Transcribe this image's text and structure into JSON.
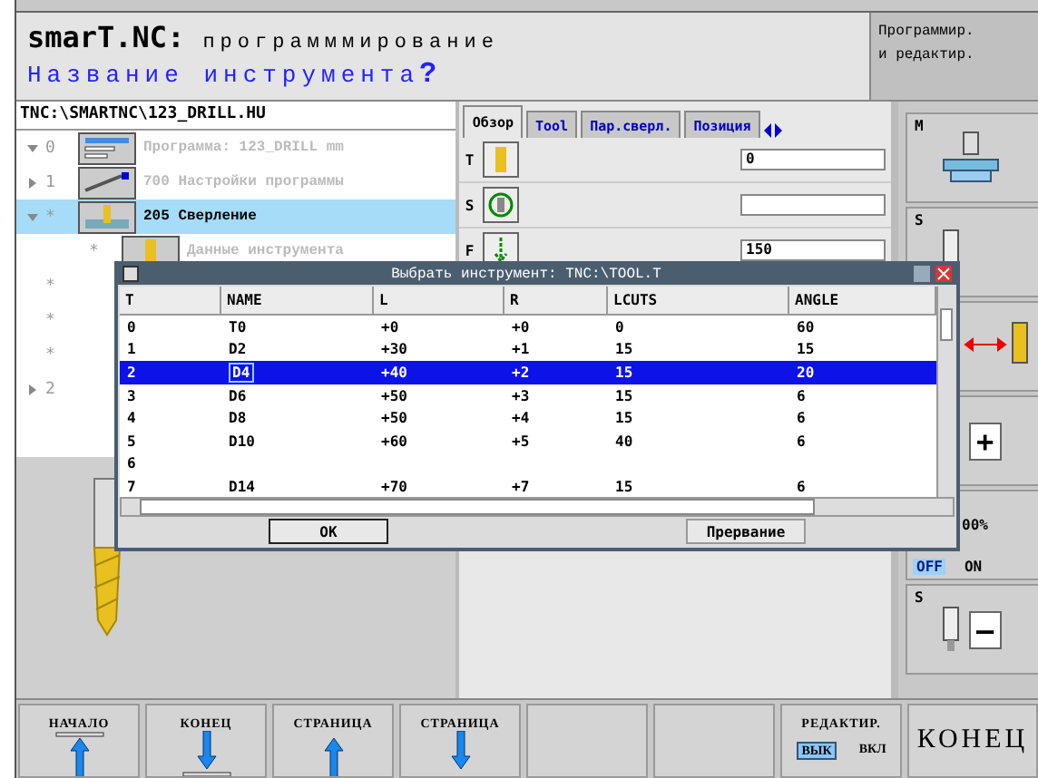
{
  "header": {
    "title": "smarT.NC:",
    "subtitle": "программмирование",
    "prompt": "Название инструмента",
    "prompt_mark": "?",
    "mode": [
      "Программир.",
      "и редактир."
    ]
  },
  "file_path": "TNC:\\SMARTNC\\123_DRILL.HU",
  "tree": [
    {
      "marker": "0",
      "expanded": true,
      "selected": false,
      "kind": "program",
      "label": "Программа: 123_DRILL mm"
    },
    {
      "marker": "1",
      "expanded": false,
      "selected": false,
      "kind": "settings",
      "label": "700 Настройки программы"
    },
    {
      "marker": "*",
      "expanded": true,
      "selected": true,
      "kind": "drilling",
      "label": "205 Сверление"
    },
    {
      "marker": "*",
      "kind": "tool",
      "label": "Данные инструмента"
    },
    {
      "marker": "*"
    },
    {
      "marker": "*"
    },
    {
      "marker": "*"
    },
    {
      "marker": "2",
      "expanded": false
    }
  ],
  "tabs": [
    {
      "label": "Обзор",
      "selected": true
    },
    {
      "label": "Tool",
      "selected": false
    },
    {
      "label": "Пар.сверл.",
      "selected": false
    },
    {
      "label": "Позиция",
      "selected": false
    }
  ],
  "fields": [
    {
      "label": "T",
      "kind": "tool",
      "value": "0"
    },
    {
      "label": "S",
      "kind": "spindle"
    },
    {
      "label": "F",
      "kind": "feed",
      "value": "150"
    }
  ],
  "side_keys": [
    {
      "kind": "m",
      "label": "M"
    },
    {
      "kind": "s",
      "label": "S"
    },
    {
      "kind": "swap"
    },
    {
      "kind": "plus",
      "sign": "+"
    },
    {
      "kind": "override",
      "label": "00%",
      "off": "OFF",
      "on": "ON"
    },
    {
      "kind": "minus",
      "label": "S",
      "sign": "—"
    }
  ],
  "dialog": {
    "title": "Выбрать инструмент: TNC:\\TOOL.T",
    "columns": [
      "T",
      "NAME",
      "L",
      "R",
      "LCUTS",
      "ANGLE"
    ],
    "rows": [
      {
        "selected": false,
        "cells": [
          "0",
          "T0",
          "+0",
          "+0",
          "0",
          "60"
        ]
      },
      {
        "selected": false,
        "cells": [
          "1",
          "D2",
          "+30",
          "+1",
          "15",
          "15"
        ]
      },
      {
        "selected": true,
        "cells": [
          "2",
          "D4",
          "+40",
          "+2",
          "15",
          "20"
        ]
      },
      {
        "selected": false,
        "cells": [
          "3",
          "D6",
          "+50",
          "+3",
          "15",
          "6"
        ]
      },
      {
        "selected": false,
        "cells": [
          "4",
          "D8",
          "+50",
          "+4",
          "15",
          "6"
        ]
      },
      {
        "selected": false,
        "cells": [
          "5",
          "D10",
          "+60",
          "+5",
          "40",
          "6"
        ]
      },
      {
        "selected": false,
        "cells": [
          "6"
        ]
      },
      {
        "selected": false,
        "cells": [
          "7",
          "D14",
          "+70",
          "+7",
          "15",
          "6"
        ]
      }
    ],
    "buttons": [
      "OK",
      "Прервание"
    ]
  },
  "softkeys": [
    {
      "kind": "up_top",
      "label": "НАЧАЛО"
    },
    {
      "kind": "down_bottom",
      "label": "КОНЕЦ"
    },
    {
      "kind": "up",
      "label": "СТРАНИЦА"
    },
    {
      "kind": "down",
      "label": "СТРАНИЦА"
    },
    {
      "kind": "empty"
    },
    {
      "kind": "empty"
    },
    {
      "kind": "toggle",
      "label": "РЕДАКТИР.",
      "off": "ВЫК",
      "on": "ВКЛ",
      "state_on": false
    },
    {
      "kind": "text",
      "label": "КОНЕЦ"
    }
  ]
}
